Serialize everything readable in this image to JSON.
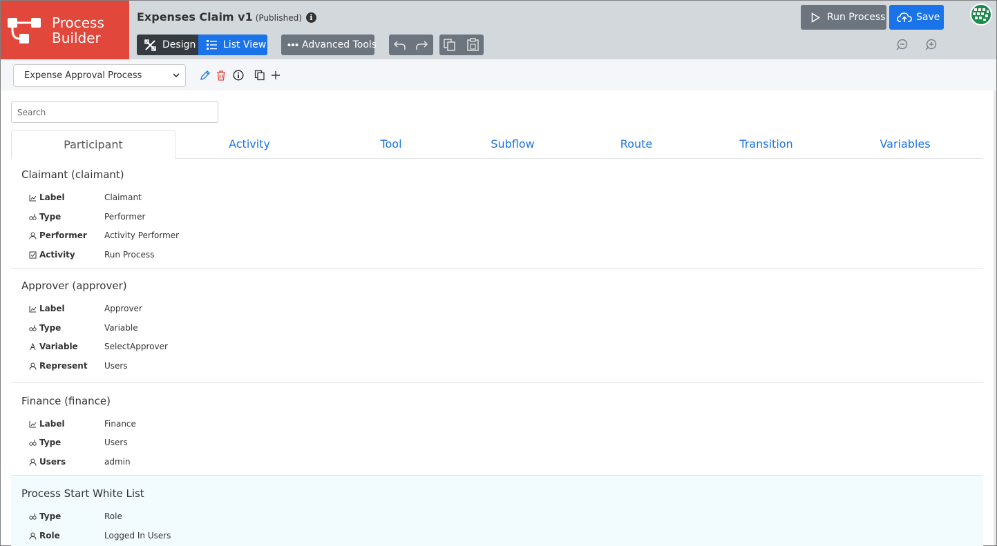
{
  "brand": {
    "name_line1": "Process",
    "name_line2": "Builder",
    "color": "#e2473b"
  },
  "header": {
    "title": "Expenses Claim v1",
    "status": "(Published)",
    "design_label": "Design",
    "listview_label": "List View",
    "advanced_label": "Advanced Tools",
    "run_label": "Run Process",
    "save_label": "Save",
    "accent": "#1a73e8"
  },
  "process": {
    "selected": "Expense Approval Process"
  },
  "search": {
    "placeholder": "Search"
  },
  "tabs": [
    {
      "label": "Participant",
      "active": true
    },
    {
      "label": "Activity"
    },
    {
      "label": "Tool"
    },
    {
      "label": "Subflow"
    },
    {
      "label": "Route"
    },
    {
      "label": "Transition"
    },
    {
      "label": "Variables"
    }
  ],
  "sections": [
    {
      "title": "Claimant (claimant)",
      "rows": [
        {
          "icon": "label-icon",
          "label": "Label",
          "value": "Claimant"
        },
        {
          "icon": "type-icon",
          "label": "Type",
          "value": "Performer"
        },
        {
          "icon": "user-icon",
          "label": "Performer",
          "value": "Activity Performer"
        },
        {
          "icon": "checkbox-icon",
          "label": "Activity",
          "value": "Run Process"
        }
      ]
    },
    {
      "title": "Approver (approver)",
      "rows": [
        {
          "icon": "label-icon",
          "label": "Label",
          "value": "Approver"
        },
        {
          "icon": "type-icon",
          "label": "Type",
          "value": "Variable"
        },
        {
          "icon": "variable-icon",
          "label": "Variable",
          "value": "SelectApprover"
        },
        {
          "icon": "user-icon",
          "label": "Represent",
          "value": "Users"
        }
      ]
    },
    {
      "title": "Finance (finance)",
      "rows": [
        {
          "icon": "label-icon",
          "label": "Label",
          "value": "Finance"
        },
        {
          "icon": "type-icon",
          "label": "Type",
          "value": "Users"
        },
        {
          "icon": "user-icon",
          "label": "Users",
          "value": "admin"
        }
      ]
    },
    {
      "title": "Process Start White List",
      "rows": [
        {
          "icon": "type-icon",
          "label": "Type",
          "value": "Role"
        },
        {
          "icon": "user-icon",
          "label": "Role",
          "value": "Logged In Users"
        }
      ]
    }
  ]
}
